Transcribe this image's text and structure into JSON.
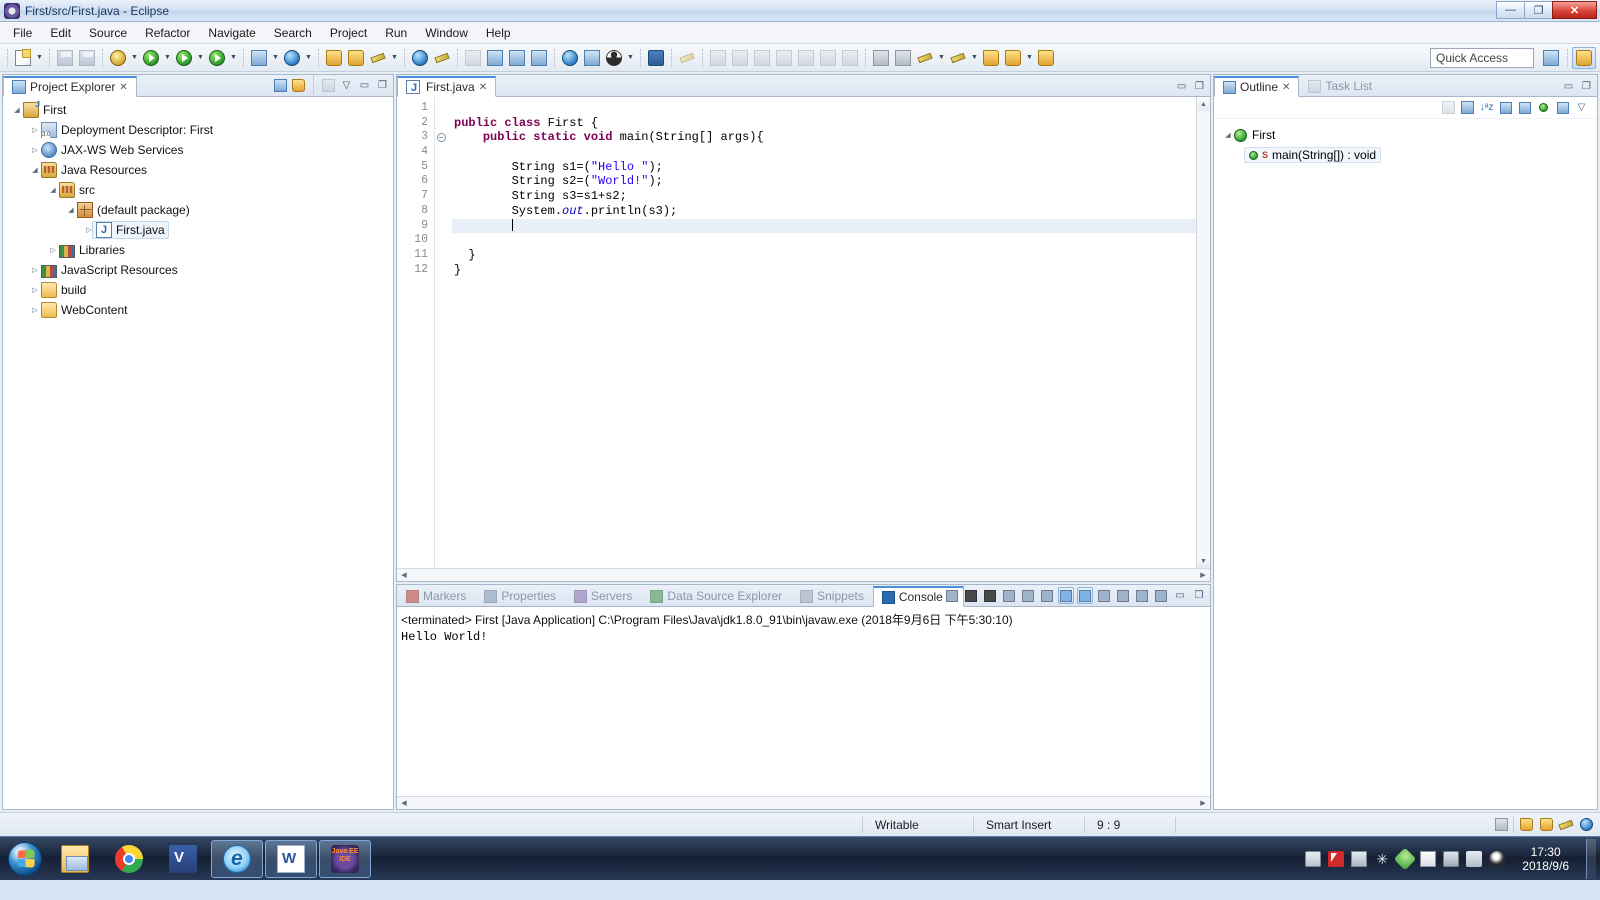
{
  "window": {
    "title": "First/src/First.java - Eclipse",
    "icon": "eclipse-icon",
    "controls": {
      "minimize": "—",
      "restore": "❐",
      "close": "✕"
    }
  },
  "menubar": {
    "items": [
      "File",
      "Edit",
      "Source",
      "Refactor",
      "Navigate",
      "Search",
      "Project",
      "Run",
      "Window",
      "Help"
    ]
  },
  "toolbar": {
    "quick_access_placeholder": "Quick Access",
    "left_groups": [
      {
        "icons": [
          "new-wizard-icon",
          "dropdown-arrow"
        ]
      },
      {
        "icons": [
          "save-icon",
          "save-all-icon"
        ]
      },
      {
        "icons": [
          "debug-icon",
          "dropdown-arrow",
          "run-icon",
          "dropdown-arrow",
          "run-as-server-icon",
          "dropdown-arrow",
          "run-coverage-icon",
          "dropdown-arrow"
        ]
      },
      {
        "icons": [
          "new-java-project-icon",
          "dropdown-arrow",
          "new-servlet-icon",
          "dropdown-arrow"
        ]
      },
      {
        "icons": [
          "open-type-icon",
          "open-task-icon",
          "edit-icon",
          "dropdown-arrow"
        ]
      },
      {
        "icons": [
          "external-tools-icon",
          "toggle-markup-icon"
        ]
      }
    ],
    "right_groups": [
      {
        "icons": [
          "search-icon",
          "new-jsp-icon",
          "new-css-icon",
          "paragraph-icon"
        ]
      },
      {
        "icons": [
          "web-browser-icon",
          "link-editor-icon",
          "user-icon",
          "dropdown-arrow"
        ]
      },
      {
        "icons": [
          "console-icon",
          "pin-icon"
        ]
      },
      {
        "icons": [
          "step-into-icon",
          "step-over-icon",
          "step-return-icon",
          "skip-breakpoints-icon",
          "resume-icon",
          "suspend-icon",
          "terminate-icon"
        ]
      },
      {
        "icons": [
          "next-annotation-icon",
          "previous-annotation-icon",
          "last-edit-icon",
          "dropdown-arrow",
          "back-icon",
          "dropdown-arrow",
          "forward-icon",
          "history-back-icon",
          "dropdown-arrow",
          "history-forward-icon"
        ]
      }
    ],
    "perspective_buttons": [
      "open-perspective-icon",
      "java-ee-perspective-icon"
    ]
  },
  "project_explorer": {
    "tab_label": "Project Explorer",
    "tab_icon": "project-explorer-icon",
    "tab_close": "✕",
    "view_tools": [
      "collapse-all-icon",
      "link-with-editor-icon",
      "focus-icon",
      "view-menu-icon",
      "minimize-icon",
      "maximize-icon"
    ],
    "tree": [
      {
        "label": "First",
        "icon": "java-project-icon",
        "indent": 0,
        "twisty": "expanded"
      },
      {
        "label": "Deployment Descriptor: First",
        "icon": "deployment-descriptor-icon",
        "indent": 1,
        "twisty": "collapsed"
      },
      {
        "label": "JAX-WS Web Services",
        "icon": "web-services-icon",
        "indent": 1,
        "twisty": "collapsed"
      },
      {
        "label": "Java Resources",
        "icon": "java-resources-icon",
        "indent": 1,
        "twisty": "expanded"
      },
      {
        "label": "src",
        "icon": "source-folder-icon",
        "indent": 2,
        "twisty": "expanded"
      },
      {
        "label": "(default package)",
        "icon": "package-icon",
        "indent": 3,
        "twisty": "expanded"
      },
      {
        "label": "First.java",
        "icon": "java-file-icon",
        "indent": 4,
        "twisty": "collapsed",
        "selected": true
      },
      {
        "label": "Libraries",
        "icon": "library-icon",
        "indent": 2,
        "twisty": "collapsed"
      },
      {
        "label": "JavaScript Resources",
        "icon": "library-icon",
        "indent": 1,
        "twisty": "collapsed"
      },
      {
        "label": "build",
        "icon": "folder-icon",
        "indent": 1,
        "twisty": "collapsed"
      },
      {
        "label": "WebContent",
        "icon": "folder-icon",
        "indent": 1,
        "twisty": "collapsed"
      }
    ]
  },
  "editor": {
    "tab_label": "First.java",
    "tab_icon": "java-file-icon",
    "tab_close": "✕",
    "view_tools": [
      "minimize-icon",
      "maximize-icon"
    ],
    "line_numbers": [
      "1",
      "2",
      "3",
      "4",
      "5",
      "6",
      "7",
      "8",
      "9",
      "10",
      "11",
      "12"
    ],
    "fold_marker_line": 3,
    "current_line": 9,
    "code_lines": [
      {
        "n": 1,
        "segments": []
      },
      {
        "n": 2,
        "segments": [
          {
            "t": "public ",
            "c": "kw"
          },
          {
            "t": "class ",
            "c": "kw"
          },
          {
            "t": "First {",
            "c": ""
          }
        ]
      },
      {
        "n": 3,
        "segments": [
          {
            "t": "    ",
            "c": ""
          },
          {
            "t": "public ",
            "c": "kw"
          },
          {
            "t": "static ",
            "c": "kw"
          },
          {
            "t": "void ",
            "c": "kw"
          },
          {
            "t": "main(String[] args){",
            "c": ""
          }
        ]
      },
      {
        "n": 4,
        "segments": []
      },
      {
        "n": 5,
        "segments": [
          {
            "t": "        String s1=(",
            "c": ""
          },
          {
            "t": "\"Hello \"",
            "c": "str"
          },
          {
            "t": ");",
            "c": ""
          }
        ]
      },
      {
        "n": 6,
        "segments": [
          {
            "t": "        String s2=(",
            "c": ""
          },
          {
            "t": "\"World!\"",
            "c": "str"
          },
          {
            "t": ");",
            "c": ""
          }
        ]
      },
      {
        "n": 7,
        "segments": [
          {
            "t": "        String s3=s1+s2;",
            "c": ""
          }
        ]
      },
      {
        "n": 8,
        "segments": [
          {
            "t": "        System.",
            "c": ""
          },
          {
            "t": "out",
            "c": "stat"
          },
          {
            "t": ".println(s3);",
            "c": ""
          }
        ]
      },
      {
        "n": 9,
        "segments": [
          {
            "t": "        ",
            "c": ""
          }
        ],
        "caret": true
      },
      {
        "n": 10,
        "segments": []
      },
      {
        "n": 11,
        "segments": [
          {
            "t": "  }",
            "c": ""
          }
        ]
      },
      {
        "n": 12,
        "segments": [
          {
            "t": "}",
            "c": ""
          }
        ]
      }
    ]
  },
  "bottom_panel": {
    "tabs": [
      {
        "label": "Markers",
        "icon": "markers-icon",
        "active": false
      },
      {
        "label": "Properties",
        "icon": "properties-icon",
        "active": false
      },
      {
        "label": "Servers",
        "icon": "servers-icon",
        "active": false
      },
      {
        "label": "Data Source Explorer",
        "icon": "data-source-icon",
        "active": false
      },
      {
        "label": "Snippets",
        "icon": "snippets-icon",
        "active": false
      },
      {
        "label": "Console",
        "icon": "console-icon",
        "active": true,
        "close": "✕"
      }
    ],
    "tools": [
      "clear-icon",
      "terminate-icon",
      "remove-all-terminated-icon",
      "open-console-icon",
      "pin-console-icon",
      "display-selected-console-icon",
      "scroll-lock-icon",
      "word-wrap-icon",
      "show-console-on-output-icon",
      "open-console-dropdown-icon",
      "new-console-view-icon",
      "console-options-dropdown-icon",
      "minimize-icon",
      "maximize-icon"
    ],
    "console": {
      "launch_line": "<terminated> First [Java Application] C:\\Program Files\\Java\\jdk1.8.0_91\\bin\\javaw.exe (2018年9月6日 下午5:30:10)",
      "output": "Hello World!"
    }
  },
  "outline": {
    "tabs": [
      {
        "label": "Outline",
        "icon": "outline-icon",
        "active": true,
        "close": "✕"
      },
      {
        "label": "Task List",
        "icon": "task-list-icon",
        "active": false
      }
    ],
    "view_tools": [
      "minimize-icon",
      "maximize-icon"
    ],
    "toolbar_icons": [
      "focus-on-selection-icon",
      "collapse-all-icon",
      "sort-icon",
      "hide-fields-icon",
      "hide-static-icon",
      "hide-non-public-icon",
      "hide-local-types-icon",
      "view-menu-icon"
    ],
    "tree": [
      {
        "label": "First",
        "icon": "class-icon",
        "indent": 0,
        "twisty": "expanded"
      },
      {
        "label": "main(String[]) : void",
        "icon": "method-icon",
        "modifier": "S",
        "indent": 1,
        "selected": true
      }
    ]
  },
  "statusbar": {
    "writable": "Writable",
    "insert_mode": "Smart Insert",
    "position": "9 : 9",
    "right_icons": [
      "heap-status-icon",
      "folder-icon",
      "print-icon",
      "pencil-icon",
      "gear-icon"
    ]
  },
  "taskbar": {
    "start_label": "start-orb",
    "apps": [
      {
        "name": "file-explorer",
        "icon": "file-explorer-icon",
        "running": false
      },
      {
        "name": "google-chrome",
        "icon": "chrome-icon",
        "running": false
      },
      {
        "name": "microsoft-visio",
        "icon": "visio-icon",
        "running": false
      },
      {
        "name": "internet-explorer",
        "icon": "ie-icon",
        "running": true
      },
      {
        "name": "microsoft-word",
        "icon": "word-icon",
        "running": true
      },
      {
        "name": "eclipse-java-ee-ide",
        "icon": "eclipse-icon",
        "running": true
      }
    ],
    "tray_icons": [
      "keyboard-icon",
      "input-method-icon",
      "window-switch-icon",
      "snowflake-icon",
      "green-shield-icon",
      "flag-alert-icon",
      "network-icon",
      "volume-muted-icon",
      "qq-penguin-icon"
    ],
    "clock": {
      "time": "17:30",
      "date": "2018/9/6"
    }
  }
}
